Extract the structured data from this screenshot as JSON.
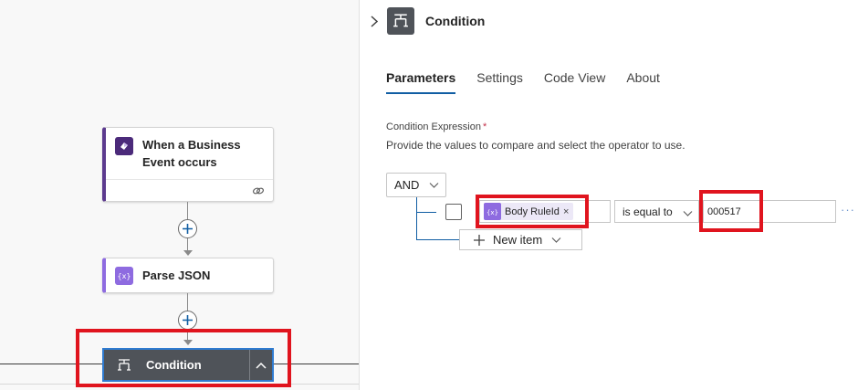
{
  "canvas": {
    "trigger_card": {
      "title": "When a Business Event occurs",
      "icon": "business-event-icon"
    },
    "parse_card": {
      "title": "Parse JSON",
      "icon": "variable-icon"
    },
    "condition_node": {
      "title": "Condition",
      "icon": "condition-icon"
    }
  },
  "panel": {
    "title": "Condition",
    "tabs": [
      {
        "label": "Parameters",
        "active": true
      },
      {
        "label": "Settings",
        "active": false
      },
      {
        "label": "Code View",
        "active": false
      },
      {
        "label": "About",
        "active": false
      }
    ],
    "condition_expression_label": "Condition Expression",
    "required_mark": "*",
    "help_text": "Provide the values to compare and select the operator to use.",
    "group_operator": "AND",
    "row": {
      "operand1_token": "Body RuleId",
      "token_remove": "×",
      "operator": "is equal to",
      "operand2_value": "000517",
      "more_label": "···"
    },
    "new_item_label": "New item"
  },
  "colors": {
    "accent": "#115ea3",
    "highlight": "#e0141e",
    "condition_node_bg": "#4f5359",
    "parse_purple": "#8e6be0",
    "trigger_purple": "#4b2a7a"
  }
}
